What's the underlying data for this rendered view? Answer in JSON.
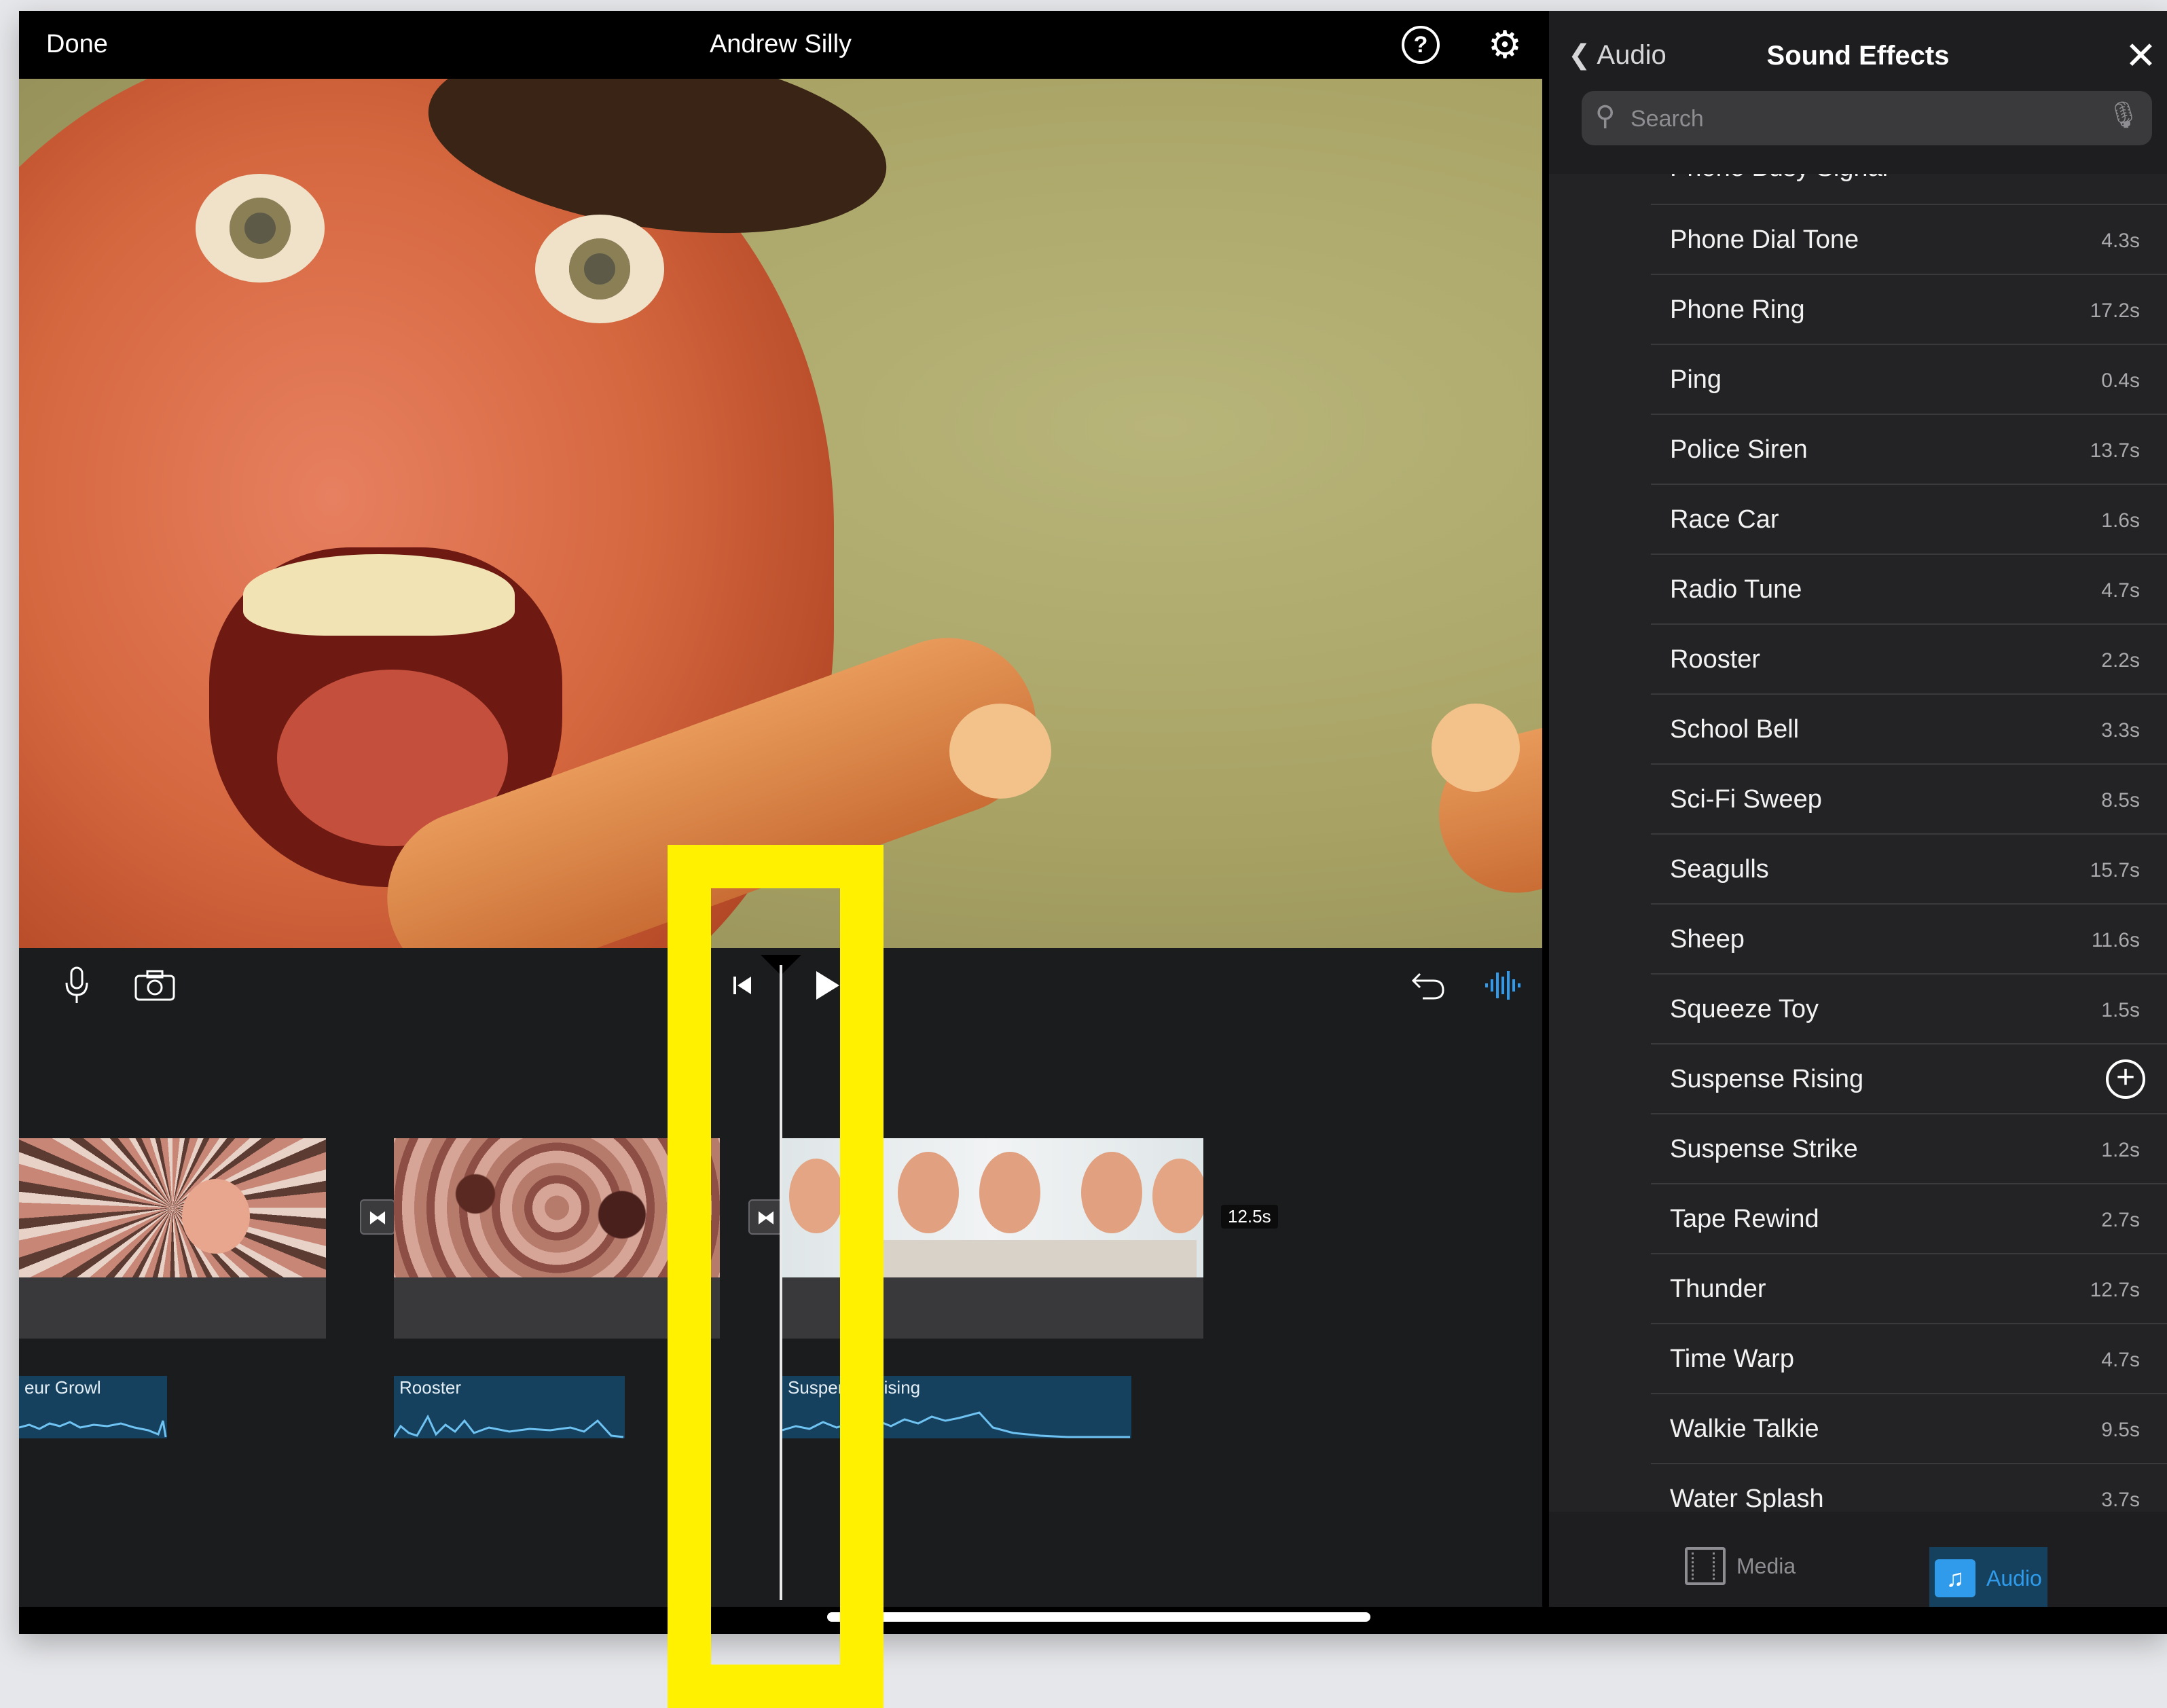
{
  "topbar": {
    "done_label": "Done",
    "project_title": "Andrew Silly",
    "help_icon": "help-icon",
    "settings_icon": "gear-icon"
  },
  "toolbar": {
    "mic_icon": "microphone-icon",
    "camera_icon": "camera-icon",
    "skip_icon": "skip-to-start-icon",
    "play_icon": "play-icon",
    "undo_icon": "undo-icon",
    "audio_icon": "waveform-icon"
  },
  "timeline": {
    "clips": [
      {
        "label": "Wormhole clip"
      },
      {
        "label": "Kaleidoscope clip"
      },
      {
        "label": "Mirrored faces clip"
      }
    ],
    "duration_badge": "12.5s",
    "audio_clips": [
      {
        "label": "eur Growl"
      },
      {
        "label": "Rooster"
      },
      {
        "label": "Suspense Rising"
      }
    ]
  },
  "panel": {
    "back_label": "Audio",
    "title": "Sound Effects",
    "search_placeholder": "Search",
    "partial_item": "Phone Busy Signal",
    "items": [
      {
        "name": "Phone Dial Tone",
        "length": "4.3s"
      },
      {
        "name": "Phone Ring",
        "length": "17.2s"
      },
      {
        "name": "Ping",
        "length": "0.4s"
      },
      {
        "name": "Police Siren",
        "length": "13.7s"
      },
      {
        "name": "Race Car",
        "length": "1.6s"
      },
      {
        "name": "Radio Tune",
        "length": "4.7s"
      },
      {
        "name": "Rooster",
        "length": "2.2s"
      },
      {
        "name": "School Bell",
        "length": "3.3s"
      },
      {
        "name": "Sci-Fi Sweep",
        "length": "8.5s"
      },
      {
        "name": "Seagulls",
        "length": "15.7s"
      },
      {
        "name": "Sheep",
        "length": "11.6s"
      },
      {
        "name": "Squeeze Toy",
        "length": "1.5s"
      },
      {
        "name": "Suspense Rising",
        "length": ""
      },
      {
        "name": "Suspense Strike",
        "length": "1.2s"
      },
      {
        "name": "Tape Rewind",
        "length": "2.7s"
      },
      {
        "name": "Thunder",
        "length": "12.7s"
      },
      {
        "name": "Time Warp",
        "length": "4.7s"
      },
      {
        "name": "Walkie Talkie",
        "length": "9.5s"
      },
      {
        "name": "Water Splash",
        "length": "3.7s"
      }
    ],
    "tabs": {
      "media": "Media",
      "audio": "Audio"
    }
  },
  "colors": {
    "accent": "#2f9bea",
    "highlight": "#fff100",
    "audio_track": "#16415e"
  }
}
